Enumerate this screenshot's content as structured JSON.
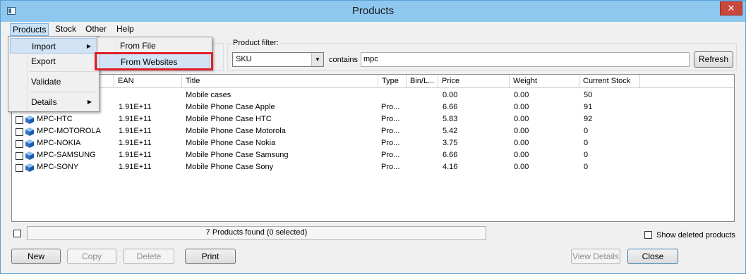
{
  "window": {
    "title": "Products"
  },
  "menubar": {
    "items": [
      "Products",
      "Stock",
      "Other",
      "Help"
    ]
  },
  "products_menu": {
    "items": [
      {
        "label": "Import",
        "has_submenu": true
      },
      {
        "label": "Export",
        "has_submenu": false
      },
      {
        "label": "Validate",
        "has_submenu": false
      },
      {
        "label": "Details",
        "has_submenu": true
      }
    ]
  },
  "import_submenu": {
    "items": [
      {
        "label": "From File"
      },
      {
        "label": "From Websites"
      }
    ]
  },
  "filter": {
    "group_label": "Product filter:",
    "field": "SKU",
    "operator_label": "contains",
    "value": "mpc",
    "refresh_label": "Refresh"
  },
  "grid": {
    "columns": [
      "",
      "EAN",
      "Title",
      "Type",
      "Bin/L...",
      "Price",
      "Weight",
      "Current Stock"
    ],
    "rows": [
      {
        "sku": "",
        "ean": "",
        "title": "Mobile cases",
        "type": "",
        "price": "0.00",
        "weight": "0.00",
        "stock": "50"
      },
      {
        "sku": "",
        "ean": "1.91E+11",
        "title": "Mobile Phone Case Apple",
        "type": "Pro...",
        "price": "6.66",
        "weight": "0.00",
        "stock": "91"
      },
      {
        "sku": "MPC-HTC",
        "ean": "1.91E+11",
        "title": "Mobile Phone Case HTC",
        "type": "Pro...",
        "price": "5.83",
        "weight": "0.00",
        "stock": "92"
      },
      {
        "sku": "MPC-MOTOROLA",
        "ean": "1.91E+11",
        "title": "Mobile Phone Case Motorola",
        "type": "Pro...",
        "price": "5.42",
        "weight": "0.00",
        "stock": "0"
      },
      {
        "sku": "MPC-NOKIA",
        "ean": "1.91E+11",
        "title": "Mobile Phone Case Nokia",
        "type": "Pro...",
        "price": "3.75",
        "weight": "0.00",
        "stock": "0"
      },
      {
        "sku": "MPC-SAMSUNG",
        "ean": "1.91E+11",
        "title": "Mobile Phone Case Samsung",
        "type": "Pro...",
        "price": "6.66",
        "weight": "0.00",
        "stock": "0"
      },
      {
        "sku": "MPC-SONY",
        "ean": "1.91E+11",
        "title": "Mobile Phone Case Sony",
        "type": "Pro...",
        "price": "4.16",
        "weight": "0.00",
        "stock": "0"
      }
    ]
  },
  "status": {
    "text": "7 Products found (0 selected)",
    "show_deleted_label": "Show deleted products"
  },
  "buttons": {
    "new": "New",
    "copy": "Copy",
    "delete": "Delete",
    "print": "Print",
    "view_details": "View Details",
    "close": "Close"
  },
  "colors": {
    "accent": "#e0202a",
    "titlebar": "#8ec8ef",
    "close": "#c7473a"
  }
}
